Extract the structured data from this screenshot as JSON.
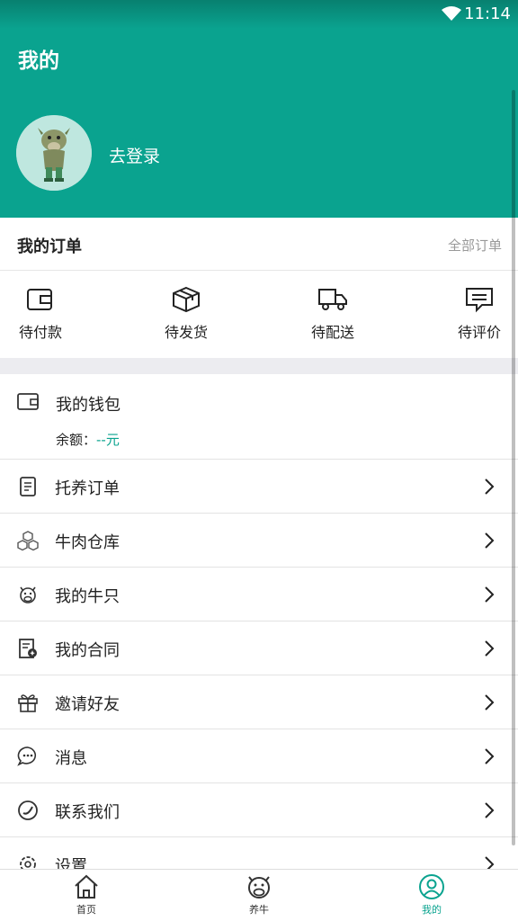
{
  "status_bar": {
    "time": "11:14",
    "wifi_icon": "wifi-icon"
  },
  "header": {
    "title": "我的",
    "login_text": "去登录",
    "avatar_icon": "cow-avatar-icon"
  },
  "orders": {
    "title": "我的订单",
    "all_link": "全部订单",
    "items": [
      {
        "label": "待付款",
        "icon": "wallet-icon"
      },
      {
        "label": "待发货",
        "icon": "package-icon"
      },
      {
        "label": "待配送",
        "icon": "truck-icon"
      },
      {
        "label": "待评价",
        "icon": "comment-icon"
      }
    ]
  },
  "wallet": {
    "title": "我的钱包",
    "balance_label": "余额：",
    "balance_value": "--元",
    "icon": "wallet-icon"
  },
  "menu": [
    {
      "label": "托养订单",
      "icon": "document-icon"
    },
    {
      "label": "牛肉仓库",
      "icon": "boxes-icon"
    },
    {
      "label": "我的牛只",
      "icon": "cow-icon"
    },
    {
      "label": "我的合同",
      "icon": "contract-icon"
    },
    {
      "label": "邀请好友",
      "icon": "gift-icon"
    },
    {
      "label": "消息",
      "icon": "chat-icon"
    },
    {
      "label": "联系我们",
      "icon": "phone-icon"
    },
    {
      "label": "设置",
      "icon": "settings-icon"
    }
  ],
  "tabbar": {
    "tabs": [
      {
        "label": "首页",
        "icon": "home-icon"
      },
      {
        "label": "养牛",
        "icon": "cow-icon"
      },
      {
        "label": "我的",
        "icon": "user-icon"
      }
    ],
    "active_color": "#0aa38f"
  },
  "colors": {
    "brand": "#0aa38f",
    "gap": "#ececf0"
  }
}
